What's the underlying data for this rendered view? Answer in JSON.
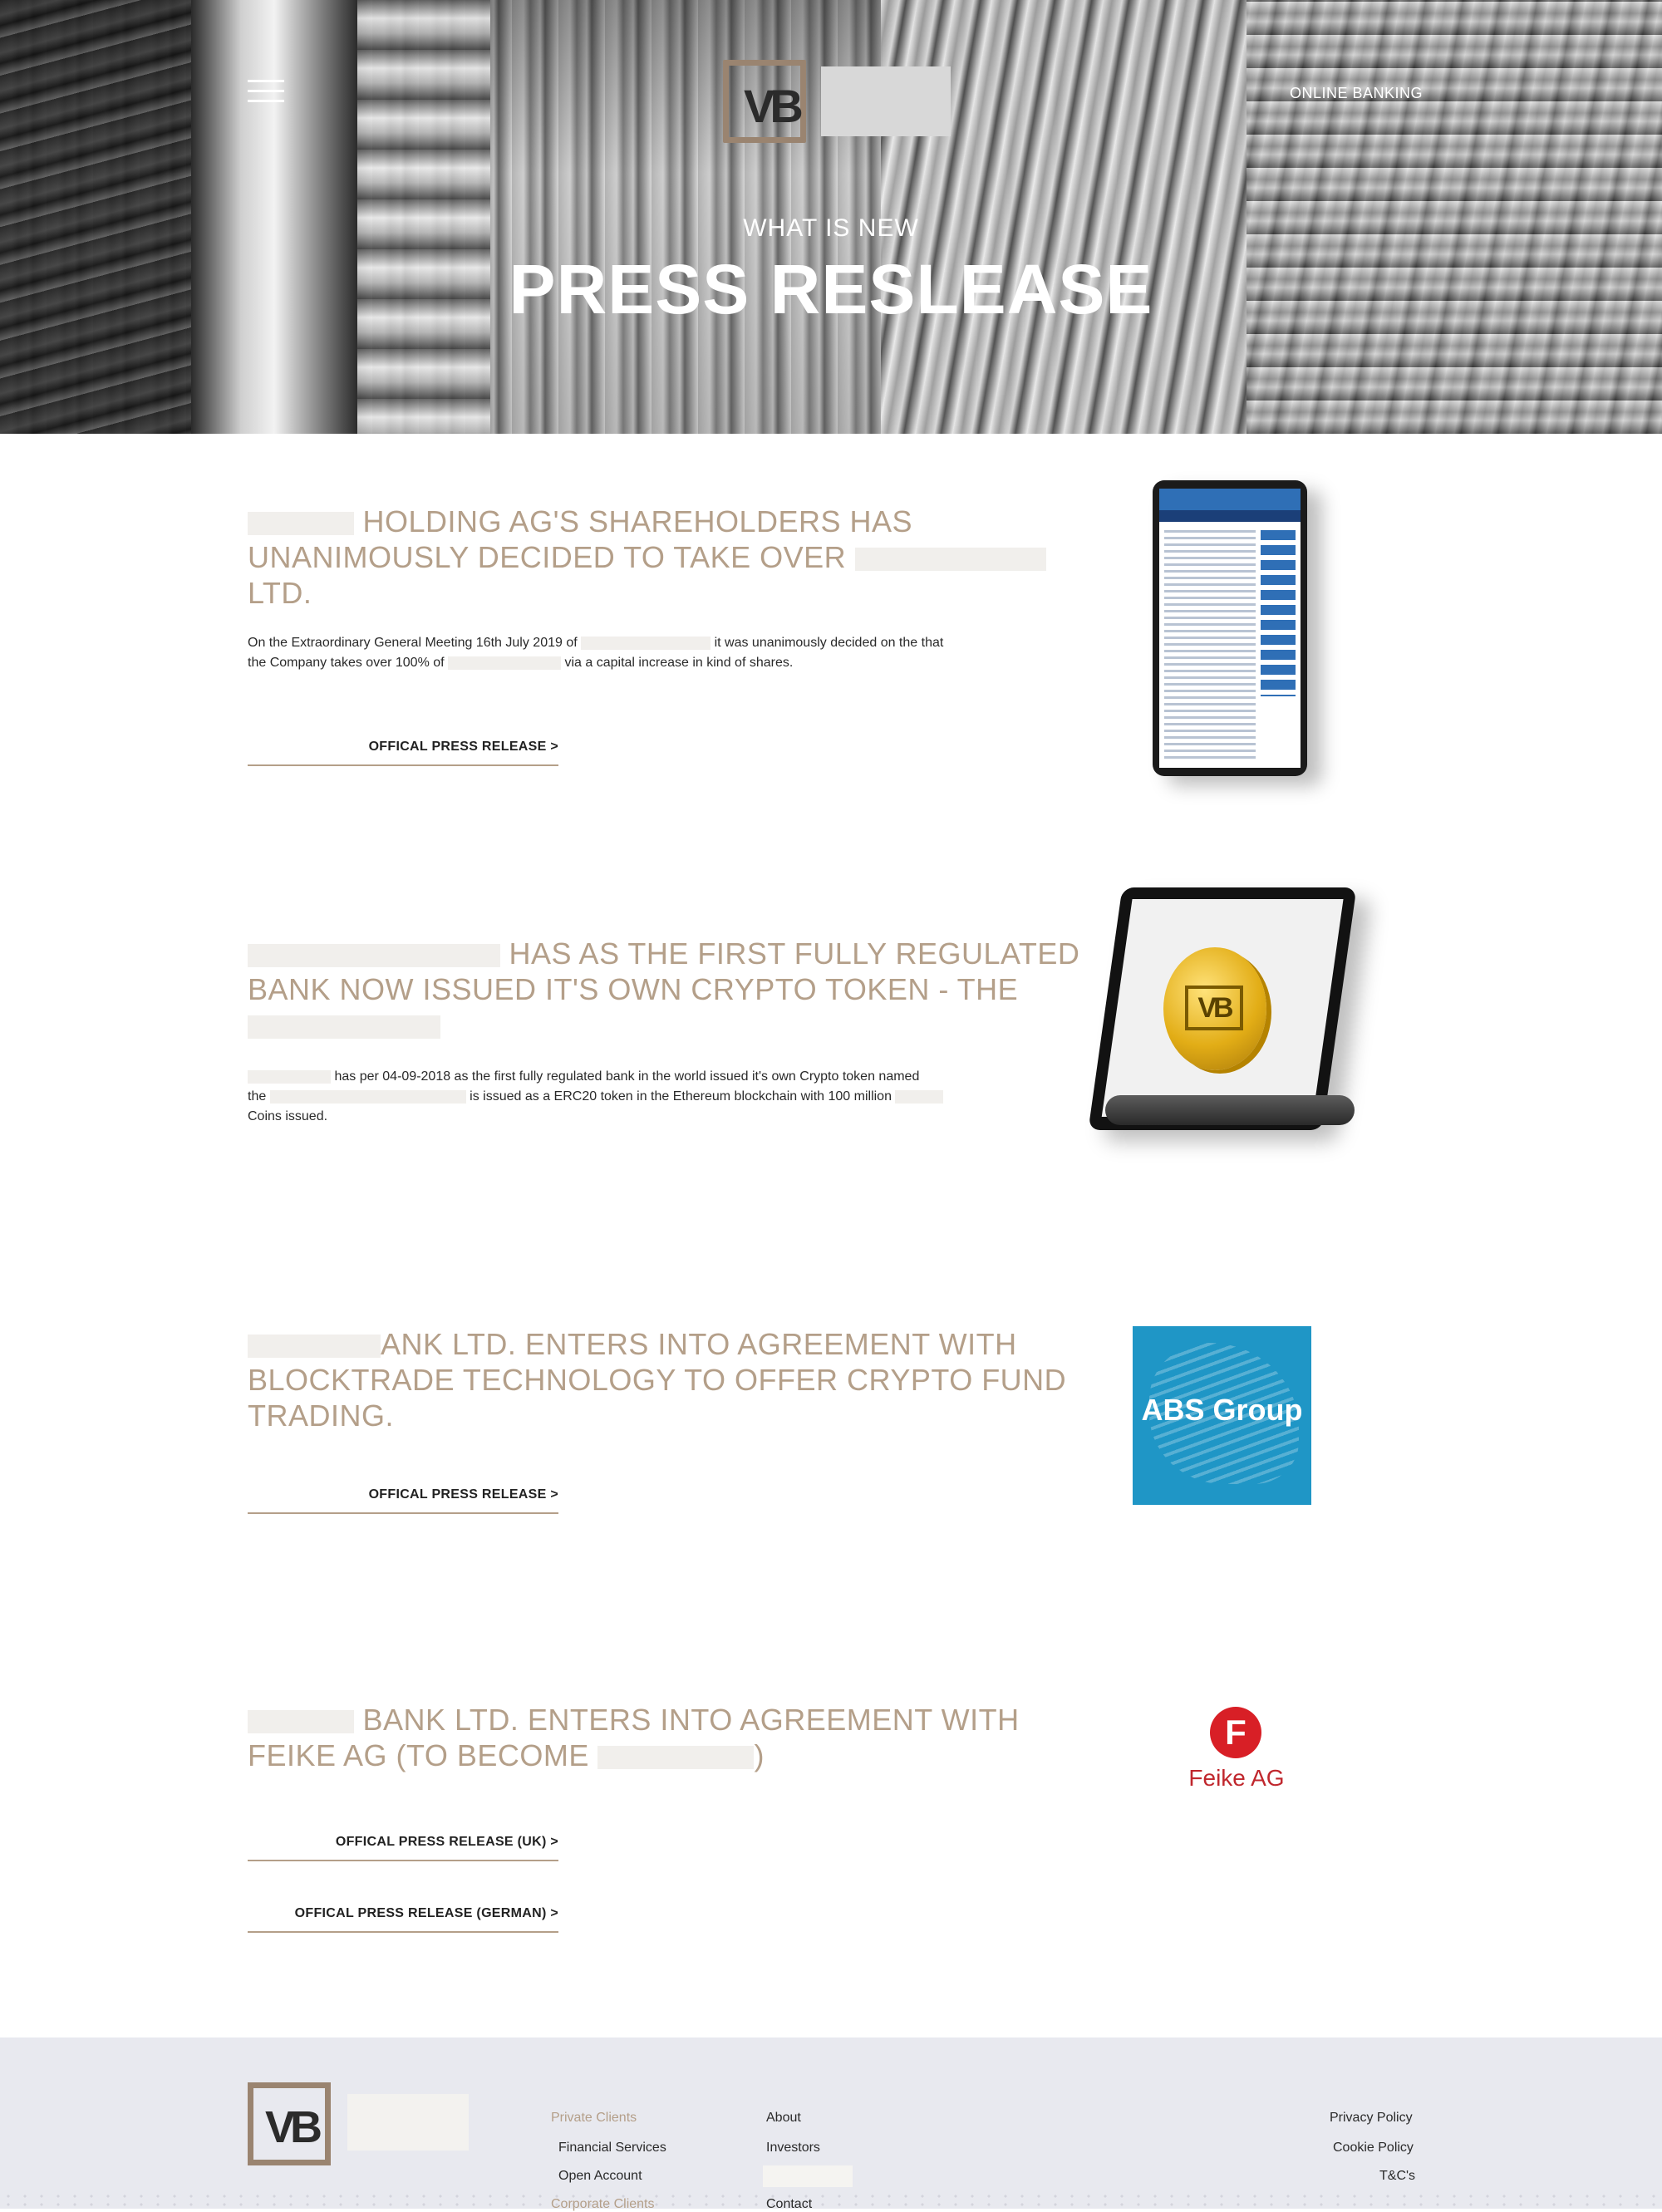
{
  "header": {
    "online_banking": "ONLINE BANKING",
    "eyebrow": "WHAT IS NEW",
    "title": "PRESS RESLEASE"
  },
  "articles": [
    {
      "title_line1": "HOLDING AG'S SHAREHOLDERS HAS",
      "title_line2": "UNANIMOUSLY DECIDED TO TAKE OVER",
      "title_line3": "LTD.",
      "body_part1": "On the Extraordinary General Meeting 16th July 2019 of",
      "body_part2": "it was unanimously decided on the that",
      "body_part3": "the Company takes over 100% of",
      "body_part4": "via a capital increase in kind of shares.",
      "link": "OFFICAL PRESS RELEASE >"
    },
    {
      "title_line1": "HAS AS THE FIRST FULLY REGULATED",
      "title_line2": "BANK NOW ISSUED IT'S OWN CRYPTO TOKEN - THE",
      "body_part1": "has per 04-09-2018 as the first fully regulated bank in the world issued it's own Crypto token named",
      "body_part2": "the",
      "body_part3": "is issued as a ERC20 token in the Ethereum blockchain with 100 million",
      "body_part4": "Coins issued."
    },
    {
      "title_line1": "ANK LTD. ENTERS INTO AGREEMENT WITH",
      "title_line2": "BLOCKTRADE TECHNOLOGY TO OFFER CRYPTO FUND",
      "title_line3": "TRADING.",
      "link": "OFFICAL PRESS RELEASE >",
      "logo_text": "ABS Group"
    },
    {
      "title_line1": "BANK LTD. ENTERS INTO AGREEMENT WITH",
      "title_line2": "FEIKE AG (TO BECOME",
      "title_paren": ")",
      "link_uk": "OFFICAL PRESS RELEASE (UK) >",
      "link_de": "OFFICAL PRESS RELEASE (GERMAN) >",
      "logo_text": "Feike AG"
    }
  ],
  "footer": {
    "col1": [
      "Private Clients",
      "Financial Services",
      "Open Account",
      "Corporate Clients"
    ],
    "col2": [
      "About",
      "Investors",
      "Contact"
    ],
    "col3": [
      "Privacy Policy",
      "Cookie Policy",
      "T&C's"
    ]
  },
  "colors": {
    "accent": "#b49f89",
    "footer_bg": "#e8e9ef",
    "abs_blue": "#1f96c6",
    "feike_red": "#d81f26"
  },
  "icons": [
    "menu-icon",
    "vb-logo",
    "tablet-image",
    "coin-image",
    "abs-group-logo",
    "feike-logo"
  ]
}
